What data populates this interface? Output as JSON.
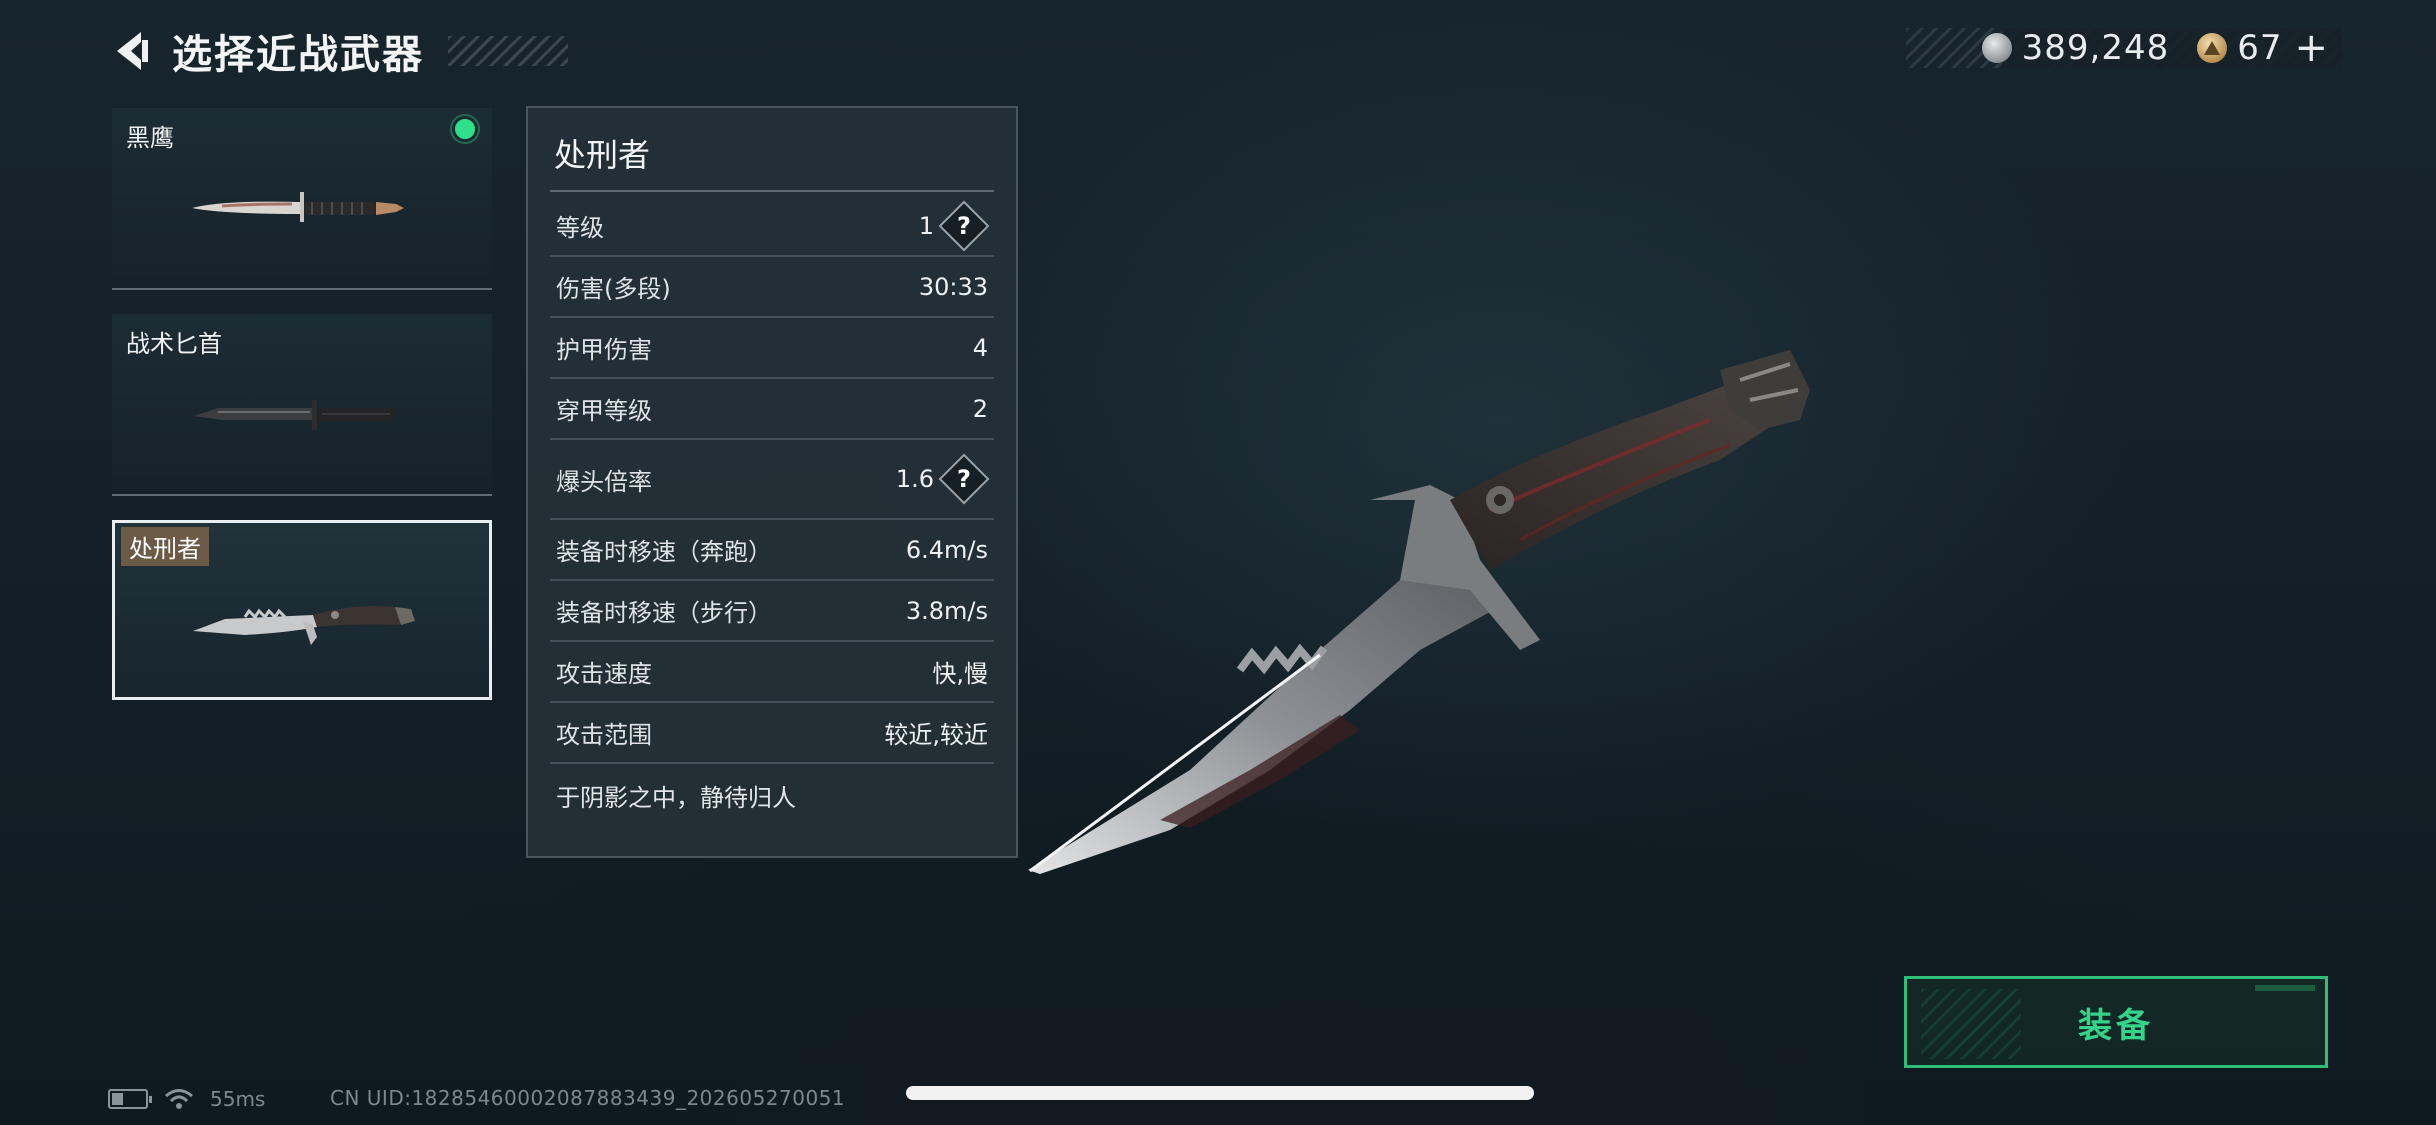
{
  "header": {
    "title": "选择近战武器",
    "back_icon": "chevron-left-icon"
  },
  "currency": {
    "silver_icon": "silver-coin-icon",
    "silver_value": "389,248",
    "gold_icon": "gold-coin-icon",
    "gold_value": "67",
    "add_label": "+"
  },
  "weapons": [
    {
      "name": "黑鹰",
      "equipped": true,
      "selected": false
    },
    {
      "name": "战术匕首",
      "equipped": false,
      "selected": false
    },
    {
      "name": "处刑者",
      "equipped": false,
      "selected": true
    }
  ],
  "details": {
    "name": "处刑者",
    "stats": [
      {
        "label": "等级",
        "value": "1",
        "help": true
      },
      {
        "label": "伤害(多段)",
        "value": "30:33",
        "help": false
      },
      {
        "label": "护甲伤害",
        "value": "4",
        "help": false
      },
      {
        "label": "穿甲等级",
        "value": "2",
        "help": false
      },
      {
        "label": "爆头倍率",
        "value": "1.6",
        "help": true
      },
      {
        "label": "装备时移速（奔跑）",
        "value": "6.4m/s",
        "help": false
      },
      {
        "label": "装备时移速（步行）",
        "value": "3.8m/s",
        "help": false
      },
      {
        "label": "攻击速度",
        "value": "快,慢",
        "help": false
      },
      {
        "label": "攻击范围",
        "value": "较近,较近",
        "help": false
      }
    ],
    "help_glyph": "?",
    "description": "于阴影之中，静待归人"
  },
  "equip_button": {
    "label": "装备"
  },
  "status": {
    "battery_level": 0.35,
    "wifi_icon": "wifi-icon",
    "ping": "55ms",
    "uid": "CN UID:18285460002087883439_202605270051"
  },
  "colors": {
    "accent_green": "#2fbf78",
    "equipped_dot": "#2ee08a",
    "background": "#17252d"
  }
}
